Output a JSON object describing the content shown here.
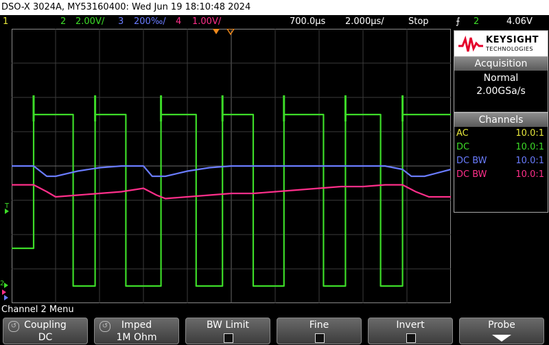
{
  "title": "DSO-X 3024A, MY53160400: Wed Jun 19 18:10:48 2024",
  "status": {
    "ch1": "1",
    "ch2_num": "2",
    "ch2_scale": "2.00V/",
    "ch3_num": "3",
    "ch3_scale": "200‰/",
    "ch4_num": "4",
    "ch4_scale": "1.00V/",
    "time_delay": "700.0µs",
    "time_scale": "2.000µs/",
    "run_state": "Stop",
    "trig_icon": "trigger-edge-icon",
    "trig_source": "2",
    "trig_level": "4.06V"
  },
  "brand": {
    "name": "KEYSIGHT",
    "sub": "TECHNOLOGIES"
  },
  "acquisition": {
    "header": "Acquisition",
    "mode": "Normal",
    "rate": "2.00GSa/s"
  },
  "channels": {
    "header": "Channels",
    "rows": [
      {
        "coupling": "AC",
        "probe": "10.0:1",
        "color": "#e8e83c"
      },
      {
        "coupling": "DC",
        "probe": "10.0:1",
        "color": "#3ddc28"
      },
      {
        "coupling": "DC BW",
        "probe": "10.0:1",
        "color": "#6a7cff"
      },
      {
        "coupling": "DC BW",
        "probe": "10.0:1",
        "color": "#ff2f8a"
      }
    ]
  },
  "left_markers": {
    "trigger": "T",
    "ch2": "2"
  },
  "menu_title": "Channel 2 Menu",
  "softkeys": [
    {
      "top": "Coupling",
      "bottom": "DC",
      "has_knob": true
    },
    {
      "top": "Imped",
      "bottom": "1M Ohm",
      "has_knob": true
    },
    {
      "top": "BW Limit",
      "bottom": "",
      "checkbox": true
    },
    {
      "top": "Fine",
      "bottom": "",
      "checkbox": true
    },
    {
      "top": "Invert",
      "bottom": "",
      "checkbox": true
    },
    {
      "top": "Probe",
      "bottom": "",
      "arrow": true
    }
  ],
  "colors": {
    "ch1": "#e8e83c",
    "ch2": "#3ddc28",
    "ch3": "#6a7cff",
    "ch4": "#ff2f8a",
    "trigger": "#f08a1c"
  },
  "chart_data": {
    "type": "line",
    "x_divisions": 10,
    "y_divisions": 8,
    "series": [
      {
        "name": "2",
        "color": "#3ddc28",
        "x": [
          0,
          0.5,
          0.5,
          1.4,
          1.4,
          1.9,
          1.9,
          2.6,
          2.6,
          2.9,
          3.4,
          3.4,
          4.2,
          4.2,
          4.8,
          4.8,
          5.5,
          5.5,
          6.2,
          6.2,
          7.1,
          7.1,
          7.6,
          7.6,
          8.4,
          8.4,
          8.9,
          8.9,
          10
        ],
        "y": [
          -2.4,
          -2.4,
          1.5,
          1.5,
          -3.5,
          -3.5,
          1.5,
          1.5,
          -3.5,
          -3.5,
          -3.5,
          1.5,
          1.5,
          -3.5,
          -3.5,
          1.5,
          1.5,
          -3.5,
          -3.5,
          1.5,
          1.5,
          -3.5,
          -3.5,
          1.5,
          1.5,
          -3.5,
          -3.5,
          1.5,
          1.5
        ]
      },
      {
        "name": "3",
        "color": "#6a7cff",
        "x": [
          0,
          0.5,
          0.6,
          0.8,
          1.0,
          1.5,
          2.0,
          2.5,
          3.0,
          3.2,
          3.5,
          4.0,
          4.5,
          5.0,
          5.5,
          6.0,
          6.5,
          7.0,
          7.5,
          8.0,
          8.5,
          8.9,
          9.1,
          9.4,
          10
        ],
        "y": [
          0.0,
          0.0,
          -0.1,
          -0.3,
          -0.3,
          -0.15,
          -0.05,
          0.0,
          0.0,
          -0.3,
          -0.3,
          -0.15,
          -0.05,
          0.0,
          0.0,
          0.0,
          0.0,
          0.0,
          0.0,
          0.0,
          0.0,
          -0.1,
          -0.3,
          -0.3,
          -0.1
        ]
      },
      {
        "name": "4",
        "color": "#ff2f8a",
        "x": [
          0,
          0.5,
          0.8,
          1.0,
          1.5,
          2.0,
          2.5,
          3.0,
          3.3,
          3.5,
          4.0,
          4.5,
          5.0,
          5.5,
          6.0,
          6.5,
          7.0,
          7.5,
          8.0,
          8.5,
          8.9,
          9.2,
          9.5,
          10
        ],
        "y": [
          -0.55,
          -0.55,
          -0.75,
          -0.9,
          -0.85,
          -0.8,
          -0.75,
          -0.65,
          -0.85,
          -0.95,
          -0.9,
          -0.85,
          -0.8,
          -0.8,
          -0.75,
          -0.7,
          -0.65,
          -0.6,
          -0.6,
          -0.55,
          -0.55,
          -0.75,
          -0.9,
          -0.9
        ]
      }
    ]
  }
}
